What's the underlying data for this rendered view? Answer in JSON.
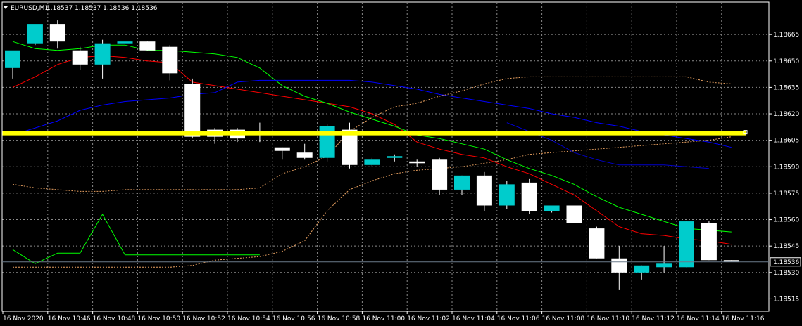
{
  "header": {
    "symbol": "EURUSD,M1",
    "ohlc": "1.18537 1.18537 1.18536 1.18536"
  },
  "chart_data": {
    "type": "candlestick",
    "ylim": [
      1.18508,
      1.18683
    ],
    "price_ticks": [
      "1.18665",
      "1.18650",
      "1.18635",
      "1.18620",
      "1.18605",
      "1.18590",
      "1.18575",
      "1.18560",
      "1.18545",
      "1.18530",
      "1.18515"
    ],
    "current_price": "1.18536",
    "time_labels": [
      "16 Nov 2020",
      "16 Nov 10:46",
      "16 Nov 10:48",
      "16 Nov 10:50",
      "16 Nov 10:52",
      "16 Nov 10:54",
      "16 Nov 10:56",
      "16 Nov 10:58",
      "16 Nov 11:00",
      "16 Nov 11:02",
      "16 Nov 11:04",
      "16 Nov 11:06",
      "16 Nov 11:08",
      "16 Nov 11:10",
      "16 Nov 11:12",
      "16 Nov 11:14",
      "16 Nov 11:16"
    ],
    "candles": [
      {
        "open": 1.18646,
        "high": 1.18655,
        "low": 1.1864,
        "close": 1.18656
      },
      {
        "open": 1.1866,
        "high": 1.1867,
        "low": 1.18659,
        "close": 1.18671
      },
      {
        "open": 1.18671,
        "high": 1.18673,
        "low": 1.18657,
        "close": 1.18661
      },
      {
        "open": 1.18656,
        "high": 1.18658,
        "low": 1.18645,
        "close": 1.18648
      },
      {
        "open": 1.18648,
        "high": 1.18662,
        "low": 1.1864,
        "close": 1.1866
      },
      {
        "open": 1.1866,
        "high": 1.18662,
        "low": 1.18656,
        "close": 1.18661
      },
      {
        "open": 1.18661,
        "high": 1.18661,
        "low": 1.18656,
        "close": 1.18656
      },
      {
        "open": 1.18658,
        "high": 1.18659,
        "low": 1.18639,
        "close": 1.18643
      },
      {
        "open": 1.18637,
        "high": 1.1864,
        "low": 1.18606,
        "close": 1.18607
      },
      {
        "open": 1.18611,
        "high": 1.18612,
        "low": 1.18603,
        "close": 1.18607
      },
      {
        "open": 1.18611,
        "high": 1.18612,
        "low": 1.18604,
        "close": 1.18606
      },
      {
        "open": 1.1861,
        "high": 1.18615,
        "low": 1.18604,
        "close": 1.18608
      },
      {
        "open": 1.18601,
        "high": 1.18601,
        "low": 1.18594,
        "close": 1.18599
      },
      {
        "open": 1.18598,
        "high": 1.18603,
        "low": 1.18594,
        "close": 1.18595
      },
      {
        "open": 1.18595,
        "high": 1.18614,
        "low": 1.18593,
        "close": 1.18613
      },
      {
        "open": 1.18611,
        "high": 1.18615,
        "low": 1.18589,
        "close": 1.18591
      },
      {
        "open": 1.18591,
        "high": 1.18595,
        "low": 1.1859,
        "close": 1.18594
      },
      {
        "open": 1.18595,
        "high": 1.18597,
        "low": 1.18593,
        "close": 1.18596
      },
      {
        "open": 1.18593,
        "high": 1.18594,
        "low": 1.1859,
        "close": 1.18592
      },
      {
        "open": 1.18594,
        "high": 1.18595,
        "low": 1.18574,
        "close": 1.18577
      },
      {
        "open": 1.18577,
        "high": 1.18585,
        "low": 1.18574,
        "close": 1.18585
      },
      {
        "open": 1.18585,
        "high": 1.18587,
        "low": 1.18565,
        "close": 1.18568
      },
      {
        "open": 1.18568,
        "high": 1.18582,
        "low": 1.18566,
        "close": 1.1858
      },
      {
        "open": 1.18581,
        "high": 1.18583,
        "low": 1.18563,
        "close": 1.18565
      },
      {
        "open": 1.18565,
        "high": 1.18568,
        "low": 1.18564,
        "close": 1.18568
      },
      {
        "open": 1.18568,
        "high": 1.18568,
        "low": 1.18558,
        "close": 1.18558
      },
      {
        "open": 1.18555,
        "high": 1.18556,
        "low": 1.18538,
        "close": 1.18538
      },
      {
        "open": 1.18538,
        "high": 1.18545,
        "low": 1.1852,
        "close": 1.1853
      },
      {
        "open": 1.1853,
        "high": 1.18534,
        "low": 1.18526,
        "close": 1.18534
      },
      {
        "open": 1.18533,
        "high": 1.18545,
        "low": 1.1853,
        "close": 1.18535
      },
      {
        "open": 1.18533,
        "high": 1.18559,
        "low": 1.18533,
        "close": 1.18559
      },
      {
        "open": 1.18558,
        "high": 1.18559,
        "low": 1.18537,
        "close": 1.18537
      },
      {
        "open": 1.18537,
        "high": 1.18537,
        "low": 1.18536,
        "close": 1.18536
      }
    ],
    "lines": [
      {
        "color": "#ff0000",
        "style": "solid",
        "values": [
          1.18635,
          1.18641,
          1.18648,
          1.18652,
          1.18653,
          1.18652,
          1.1865,
          1.18649,
          1.18638,
          1.18636,
          1.18634,
          1.18632,
          1.1863,
          1.18628,
          1.18626,
          1.18624,
          1.1862,
          1.18614,
          1.18604,
          1.186,
          1.18597,
          1.18595,
          1.1859,
          1.18586,
          1.1858,
          1.18574,
          1.18565,
          1.18556,
          1.18552,
          1.18551,
          1.18549,
          1.18548,
          1.18546
        ]
      },
      {
        "color": "#00ff00",
        "style": "solid",
        "values": [
          1.18661,
          1.18657,
          1.18656,
          1.18657,
          1.18659,
          1.18659,
          1.18656,
          1.18656,
          1.18655,
          1.18654,
          1.18652,
          1.18646,
          1.18636,
          1.1863,
          1.18626,
          1.18621,
          1.18617,
          1.18613,
          1.18608,
          1.18606,
          1.18603,
          1.186,
          1.18594,
          1.18589,
          1.18585,
          1.1858,
          1.18573,
          1.18567,
          1.18563,
          1.18559,
          1.18555,
          1.18554,
          1.18553
        ]
      },
      {
        "color": "#0000ff",
        "style": "solid",
        "values": [
          1.18608,
          1.18612,
          1.18616,
          1.18622,
          1.18625,
          1.18627,
          1.18628,
          1.18629,
          1.18631,
          1.18632,
          1.18638,
          1.18639,
          1.18639,
          1.18639,
          1.18639,
          1.18639,
          1.18638,
          1.18636,
          1.18634,
          1.18631,
          1.18629,
          1.18627,
          1.18625,
          1.18623,
          1.1862,
          1.18618,
          1.18615,
          1.18613,
          1.1861,
          1.18608,
          1.18606,
          1.18604,
          1.18601
        ]
      },
      {
        "color": "#e8a060",
        "style": "dashed",
        "values": [
          1.1858,
          1.18578,
          1.18577,
          1.18576,
          1.18576,
          1.18577,
          1.18577,
          1.18577,
          1.18577,
          1.18577,
          1.18577,
          1.18578,
          1.18586,
          1.1859,
          1.18596,
          1.1861,
          1.18618,
          1.18624,
          1.18626,
          1.1863,
          1.18633,
          1.18637,
          1.1864,
          1.18641,
          1.18641,
          1.18641,
          1.18641,
          1.18641,
          1.18641,
          1.18641,
          1.18641,
          1.18638,
          1.18637
        ]
      },
      {
        "color": "#e8a060",
        "style": "dashed",
        "values": [
          1.18533,
          1.18533,
          1.18533,
          1.18533,
          1.18533,
          1.18533,
          1.18533,
          1.18533,
          1.18534,
          1.18537,
          1.18538,
          1.18539,
          1.18542,
          1.18548,
          1.18565,
          1.18577,
          1.18582,
          1.18586,
          1.18588,
          1.18589,
          1.1859,
          1.18592,
          1.18594,
          1.18597,
          1.18598,
          1.18599,
          1.186,
          1.18601,
          1.18602,
          1.18603,
          1.18604,
          1.18605,
          1.18607
        ]
      },
      {
        "color": "#0000cc",
        "style": "solid",
        "values": [
          null,
          null,
          null,
          null,
          null,
          null,
          null,
          null,
          null,
          null,
          null,
          null,
          null,
          null,
          null,
          null,
          null,
          null,
          null,
          null,
          null,
          null,
          1.18615,
          1.1861,
          1.18605,
          1.18598,
          1.18594,
          1.18591,
          1.18591,
          1.18591,
          1.1859,
          1.18589,
          null
        ]
      },
      {
        "color": "#00ff00",
        "style": "solid",
        "values": [
          1.18543,
          1.18535,
          1.18541,
          1.18541,
          1.18563,
          1.1854,
          1.1854,
          1.1854,
          1.1854,
          1.1854,
          1.1854,
          1.1854,
          null,
          null,
          null,
          null,
          null,
          null,
          null,
          null,
          null,
          null,
          null,
          null,
          null,
          null,
          null,
          null,
          null,
          null,
          null,
          null,
          null
        ]
      }
    ],
    "level_line": {
      "price": 1.18609,
      "color": "#ffff00"
    },
    "grid": true
  }
}
